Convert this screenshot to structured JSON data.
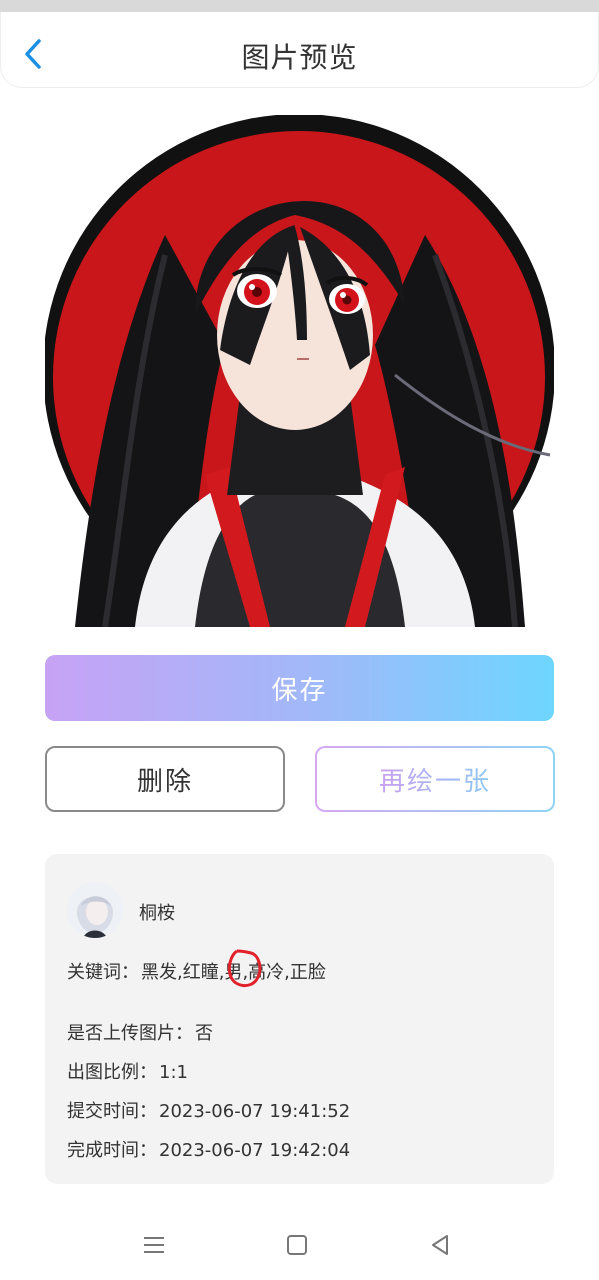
{
  "header": {
    "title": "图片预览",
    "back_icon": "chevron-left-icon",
    "back_color": "#1a8fe3"
  },
  "actions": {
    "save_label": "保存",
    "delete_label": "删除",
    "redraw_label": "再绘一张"
  },
  "info": {
    "username": "桐桉",
    "keywords_label": "关键词：",
    "keywords_value": "黑发,红瞳,男,高冷,正脸",
    "upload_label": "是否上传图片：",
    "upload_value": "否",
    "ratio_label": "出图比例：",
    "ratio_value": "1:1",
    "submit_label": "提交时间：",
    "submit_value": "2023-06-07 19:41:52",
    "complete_label": "完成时间：",
    "complete_value": "2023-06-07 19:42:04"
  },
  "colors": {
    "gradient_start": "#c7a2f5",
    "gradient_end": "#6dd6ff",
    "annotation": "#e0222a"
  },
  "navbar": {
    "icons": [
      "menu-icon",
      "home-square-icon",
      "back-triangle-icon"
    ]
  }
}
